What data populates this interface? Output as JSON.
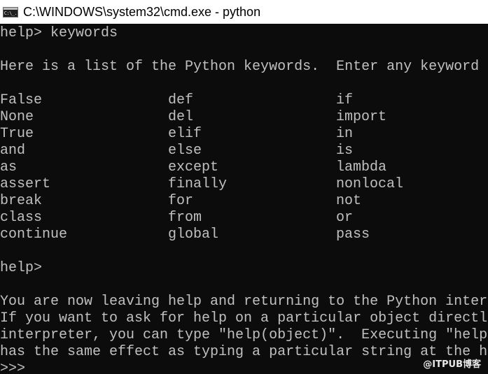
{
  "window": {
    "title": "C:\\WINDOWS\\system32\\cmd.exe - python",
    "icon": "cmd-console-icon",
    "icon_glyph": "C:\\_."
  },
  "console": {
    "lines_top": [
      "help> keywords",
      "",
      "Here is a list of the Python keywords.  Enter any keyword"
    ],
    "keywords": {
      "columns": [
        [
          "False",
          "None",
          "True",
          "and",
          "as",
          "assert",
          "break",
          "class",
          "continue"
        ],
        [
          "def",
          "del",
          "elif",
          "else",
          "except",
          "finally",
          "for",
          "from",
          "global"
        ],
        [
          "if",
          "import",
          "in",
          "is",
          "lambda",
          "nonlocal",
          "not",
          "or",
          "pass"
        ]
      ]
    },
    "prompt_help": "help>",
    "lines_bottom": [
      "You are now leaving help and returning to the Python inter",
      "If you want to ask for help on a particular object directl",
      "interpreter, you can type \"help(object)\".  Executing \"help",
      "has the same effect as typing a particular string at the h"
    ],
    "prompt_python": ">>>"
  },
  "watermark": "@ITPUB博客",
  "colors": {
    "console_bg": "#0c0c0c",
    "console_fg": "#c0c0c0",
    "titlebar_bg": "#ffffff"
  }
}
